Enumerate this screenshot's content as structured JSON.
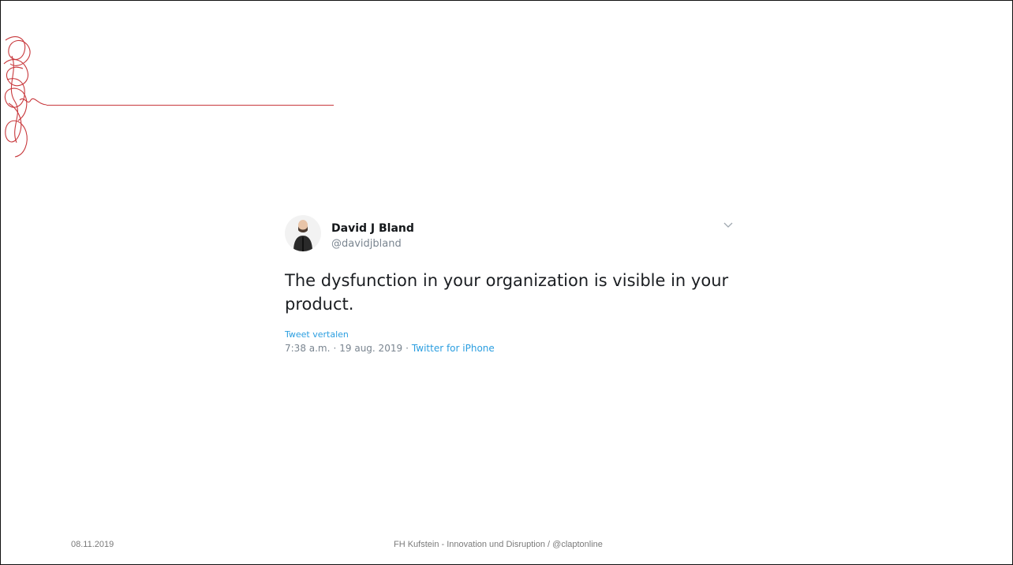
{
  "tweet": {
    "name": "David J Bland",
    "handle": "@davidjbland",
    "text": "The dysfunction in your organization is visible in your product.",
    "translate_label": "Tweet vertalen",
    "time": "7:38 a.m.",
    "date": "19 aug. 2019",
    "separator": "·",
    "source": "Twitter for iPhone"
  },
  "footer": {
    "date": "08.11.2019",
    "center": "FH Kufstein - Innovation und Disruption / @claptonline"
  },
  "colors": {
    "accent": "#c8383c",
    "link": "#2b9ee0",
    "muted": "#7a8590"
  },
  "icons": {
    "caret": "chevron-down-icon",
    "logo": "scribble-logo"
  }
}
